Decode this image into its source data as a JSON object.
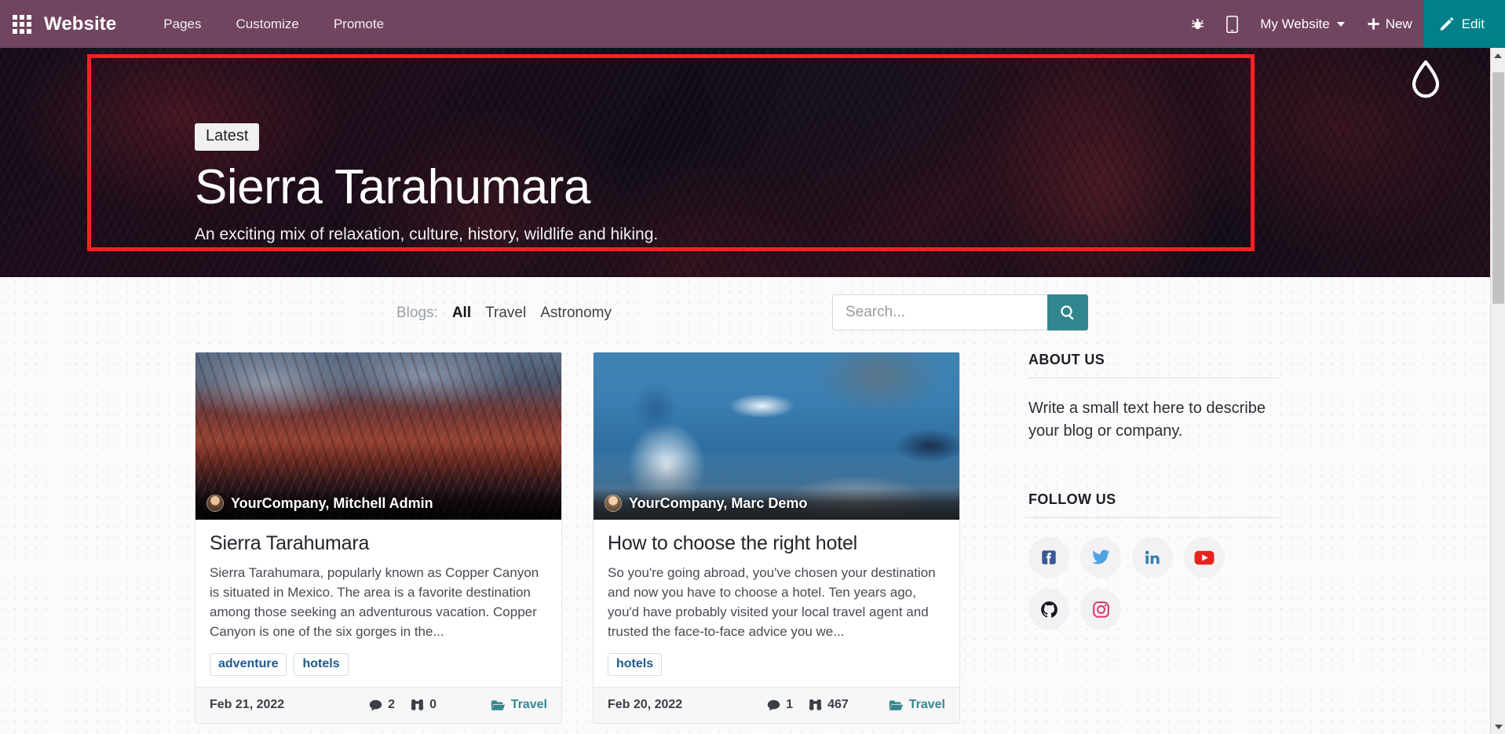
{
  "topbar": {
    "apps_icon": "grid-apps-icon",
    "brand": "Website",
    "menus": [
      "Pages",
      "Customize",
      "Promote"
    ],
    "bug_icon": "bug-icon",
    "mobile_icon": "mobile-preview-icon",
    "website_selector": "My Website",
    "new_label": "New",
    "new_icon": "plus-icon",
    "edit_label": "Edit",
    "edit_icon": "pencil-icon",
    "bg_color": "#71445f",
    "edit_color": "#00818a"
  },
  "hero": {
    "badge": "Latest",
    "title": "Sierra Tarahumara",
    "subtitle": "An exciting mix of relaxation, culture, history, wildlife and hiking.",
    "selection_color": "#ff1f25",
    "drop_icon": "water-drop-icon"
  },
  "filter": {
    "label": "Blogs:",
    "links": [
      {
        "label": "All",
        "active": true
      },
      {
        "label": "Travel",
        "active": false
      },
      {
        "label": "Astronomy",
        "active": false
      }
    ]
  },
  "search": {
    "value": "",
    "placeholder": "Search...",
    "icon": "search-icon",
    "button_color": "#33868e"
  },
  "cards": [
    {
      "author": "YourCompany, Mitchell Admin",
      "title": "Sierra Tarahumara",
      "excerpt": "Sierra Tarahumara, popularly known as Copper Canyon is situated in Mexico. The area is a favorite destination among those seeking an adventurous vacation. Copper Canyon is one of the six gorges in the...",
      "tags": [
        "adventure",
        "hotels"
      ],
      "date": "Feb 21, 2022",
      "comments": "2",
      "views": "0",
      "category": "Travel",
      "image": "mountain-sunset-thumbnail"
    },
    {
      "author": "YourCompany, Marc Demo",
      "title": "How to choose the right hotel",
      "excerpt": "So you're going abroad, you've chosen your destination and now you have to choose a hotel. Ten years ago, you'd have probably visited your local travel agent and trusted the face-to-face advice you we...",
      "tags": [
        "hotels"
      ],
      "date": "Feb 20, 2022",
      "comments": "1",
      "views": "467",
      "category": "Travel",
      "image": "santorini-seaside-thumbnail"
    }
  ],
  "sidebar": {
    "about_heading": "ABOUT US",
    "about_text": "Write a small text here to describe your blog or company.",
    "follow_heading": "FOLLOW US",
    "socials": [
      {
        "name": "facebook-icon",
        "color": "#3b5998"
      },
      {
        "name": "twitter-icon",
        "color": "#4fa3e0"
      },
      {
        "name": "linkedin-icon",
        "color": "#3a7fa8"
      },
      {
        "name": "youtube-icon",
        "color": "#e8231e"
      },
      {
        "name": "github-icon",
        "color": "#15181c"
      },
      {
        "name": "instagram-icon",
        "color": "#e0336c"
      }
    ]
  },
  "icons": {
    "comment": "comment-icon",
    "views": "binoculars-icon",
    "folder": "folder-open-icon"
  }
}
